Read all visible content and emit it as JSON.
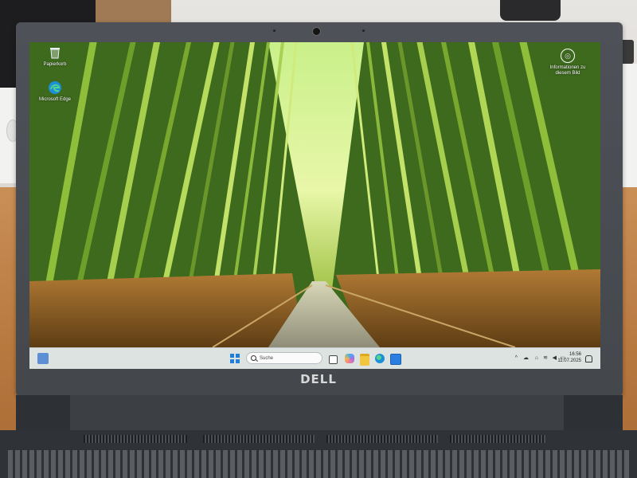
{
  "desktop": {
    "icons": [
      {
        "label": "Papierkorb",
        "icon": "recycle-bin-icon"
      },
      {
        "label": "Microsoft Edge",
        "icon": "edge-icon"
      }
    ],
    "widget": {
      "label_line1": "Informationen zu",
      "label_line2": "diesem Bild",
      "icon": "camera-info-icon"
    }
  },
  "taskbar": {
    "search_placeholder": "Suche",
    "apps": [
      "start-icon",
      "search-icon",
      "task-view-icon",
      "copilot-icon",
      "file-explorer-icon",
      "edge-icon",
      "store-icon"
    ],
    "tray": {
      "chevron": "^",
      "time": "16:56",
      "date": "11.07.2025"
    }
  },
  "brand": "DELL",
  "colors": {
    "taskbar_bg": "#e8eef0",
    "accent": "#1f7fdb",
    "bezel": "#4a4d52"
  }
}
